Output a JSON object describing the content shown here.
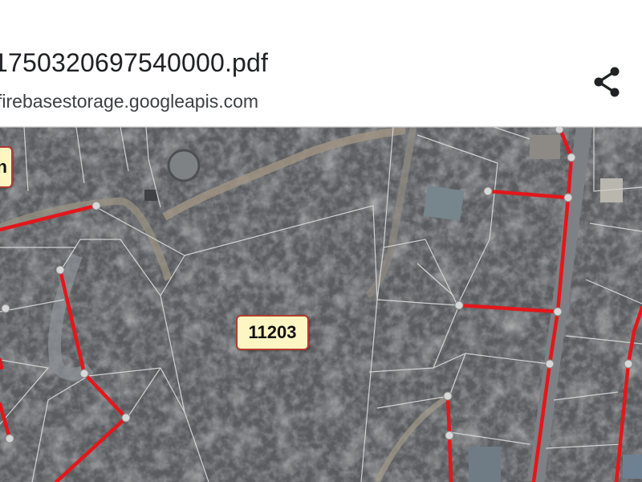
{
  "document": {
    "filename": "1750320697540000.pdf",
    "source": "firebasestorage.googleapis.com"
  },
  "toolbar": {
    "share_icon": "share-icon"
  },
  "map": {
    "parcel_labels": {
      "main": "11203",
      "partial": "n"
    }
  },
  "colors": {
    "route": "#e3171b",
    "parcel_border": "#cfcfcf",
    "label_fill": "#fdf6c3",
    "label_border": "#b23a2f",
    "node": "#d8d8d8"
  }
}
